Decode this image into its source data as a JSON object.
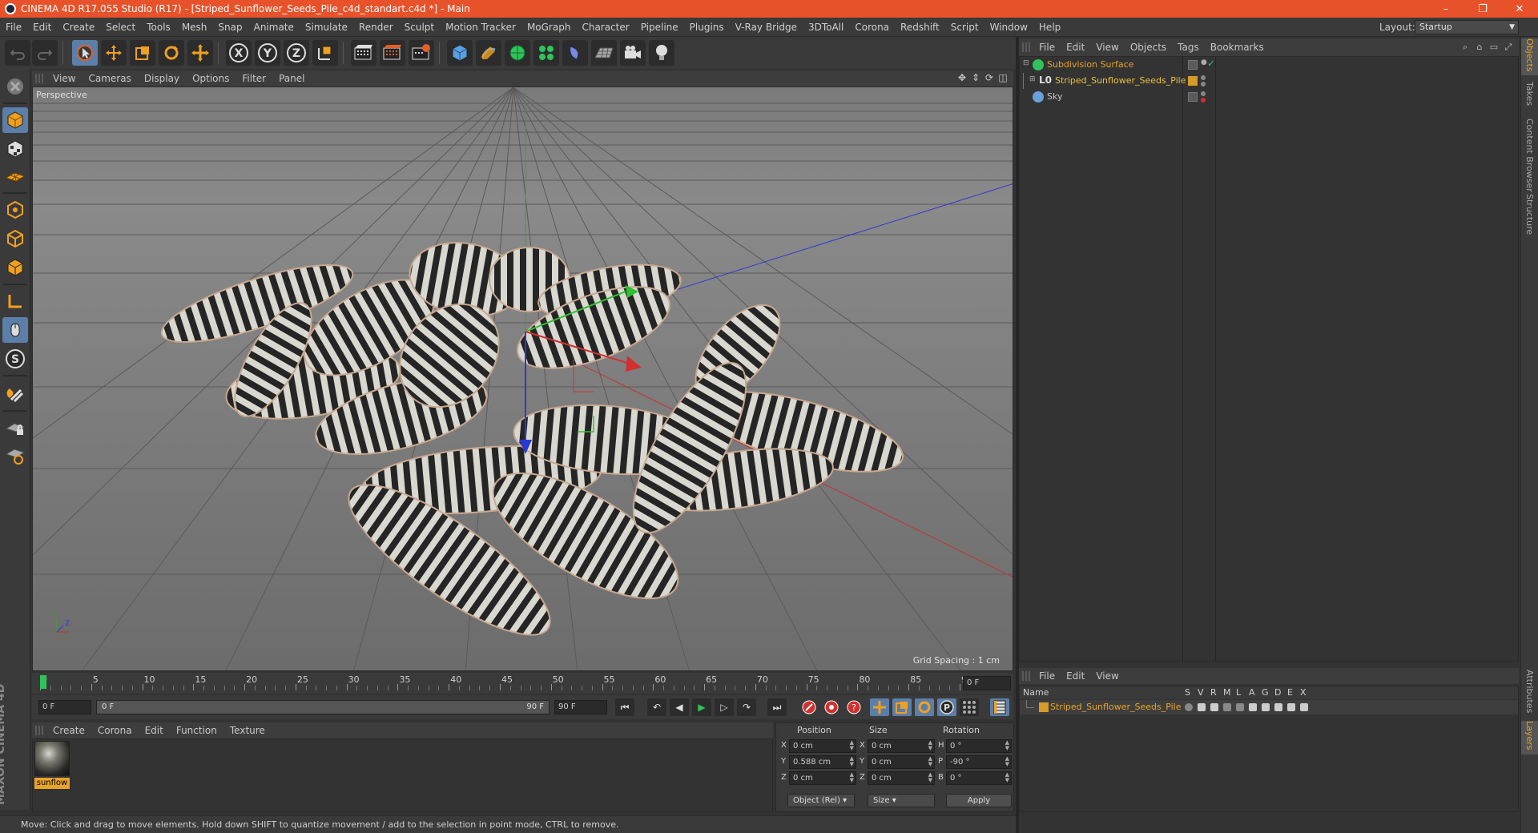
{
  "title_bar": {
    "title": "CINEMA 4D R17.055 Studio (R17) - [Striped_Sunflower_Seeds_Pile_c4d_standart.c4d *] - Main",
    "minimize": "–",
    "restore": "❐",
    "close": "✕",
    "color": "#e8522a"
  },
  "menubar": {
    "items": [
      "File",
      "Edit",
      "Create",
      "Select",
      "Tools",
      "Mesh",
      "Snap",
      "Animate",
      "Simulate",
      "Render",
      "Sculpt",
      "Motion Tracker",
      "MoGraph",
      "Character",
      "Pipeline",
      "Plugins",
      "V-Ray Bridge",
      "3DToAll",
      "Corona",
      "Redshift",
      "Script",
      "Window",
      "Help"
    ],
    "layout_label": "Layout:",
    "layout_value": "Startup"
  },
  "toolbar": {
    "icons": [
      "undo-icon",
      "redo-icon",
      "select-arrow-icon",
      "move-icon",
      "scale-icon",
      "rotate-icon",
      "move-all-icon",
      "x-axis-icon",
      "y-axis-icon",
      "z-axis-icon",
      "coordinate-system-icon",
      "render-view-icon",
      "render-picture-viewer-icon",
      "edit-render-settings-icon",
      "cube-icon",
      "pen-icon",
      "subdivision-icon",
      "cloner-icon",
      "deformer-icon",
      "floor-icon",
      "camera-icon",
      "light-icon"
    ],
    "axis_labels": [
      "X",
      "Y",
      "Z"
    ]
  },
  "left_tools": {
    "icons": [
      "make-editable-icon",
      "model-mode-icon",
      "texture-mode-icon",
      "workplane-icon",
      "points-mode-icon",
      "edges-mode-icon",
      "polygons-mode-icon",
      "axis-mode-icon",
      "tweak-mode-icon",
      "solo-icon",
      "snap-icon",
      "grid-lock-icon",
      "workplane-snap-icon"
    ],
    "solo_label": "S",
    "logo_text": "MAXON CINEMA 4D"
  },
  "viewport": {
    "menu": [
      "View",
      "Cameras",
      "Display",
      "Options",
      "Filter",
      "Panel"
    ],
    "label": "Perspective",
    "grid_spacing": "Grid Spacing : 1 cm",
    "axis_y": "Y",
    "axis_z": "Z"
  },
  "timeline": {
    "ticks": [
      "0",
      "5",
      "10",
      "15",
      "20",
      "25",
      "30",
      "35",
      "40",
      "45",
      "50",
      "55",
      "60",
      "65",
      "70",
      "75",
      "80",
      "85",
      "90"
    ],
    "current_frame": "0 F",
    "start_field": "0 F",
    "range_start": "0 F",
    "range_end": "90 F",
    "end_field": "90 F"
  },
  "transport": {
    "icons": [
      "go-to-start-icon",
      "previous-key-icon",
      "step-back-icon",
      "play-icon",
      "step-forward-icon",
      "next-key-icon",
      "go-to-end-icon",
      "record-icon",
      "autokey-icon",
      "keyframe-selection-icon",
      "position-key-icon",
      "scale-key-icon",
      "rotation-key-icon",
      "parameter-key-icon",
      "point-level-icon",
      "timeline-icon"
    ],
    "param_label": "P"
  },
  "material_manager": {
    "menu": [
      "Create",
      "Corona",
      "Edit",
      "Function",
      "Texture"
    ],
    "material_name": "sunflow"
  },
  "coordinates": {
    "headers": [
      "Position",
      "Size",
      "Rotation"
    ],
    "rows": [
      {
        "pos_label": "X",
        "pos": "0 cm",
        "size_label": "X",
        "size": "0 cm",
        "rot_label": "H",
        "rot": "0 °"
      },
      {
        "pos_label": "Y",
        "pos": "0.588 cm",
        "size_label": "Y",
        "size": "0 cm",
        "rot_label": "P",
        "rot": "-90 °"
      },
      {
        "pos_label": "Z",
        "pos": "0 cm",
        "size_label": "Z",
        "size": "0 cm",
        "rot_label": "B",
        "rot": "0 °"
      }
    ],
    "mode_dropdown": "Object (Rel)",
    "size_dropdown": "Size",
    "apply_button": "Apply"
  },
  "status_bar": {
    "text": "Move: Click and drag to move elements. Hold down SHIFT to quantize movement / add to the selection in point mode, CTRL to remove."
  },
  "object_manager": {
    "menu": [
      "File",
      "Edit",
      "View",
      "Objects",
      "Tags",
      "Bookmarks"
    ],
    "objects": [
      {
        "name": "Subdivision Surface",
        "color": "#e8a42a",
        "icon_color": "#2ec45a"
      },
      {
        "name": "Striped_Sunflower_Seeds_Pile",
        "color": "#e8c040",
        "icon_color": "#d49a2a"
      },
      {
        "name": "Sky",
        "color": "#c8c8c8",
        "icon_color": "#6aa0d8"
      }
    ]
  },
  "layer_manager": {
    "menu": [
      "File",
      "Edit",
      "View"
    ],
    "headers": [
      "Name",
      "S",
      "V",
      "R",
      "M",
      "L",
      "A",
      "G",
      "D",
      "E",
      "X"
    ],
    "layer_name": "Striped_Sunflower_Seeds_Pile"
  },
  "side_tabs": [
    "Objects",
    "Takes",
    "Content Browser",
    "Structure",
    "Attributes",
    "Layers"
  ]
}
